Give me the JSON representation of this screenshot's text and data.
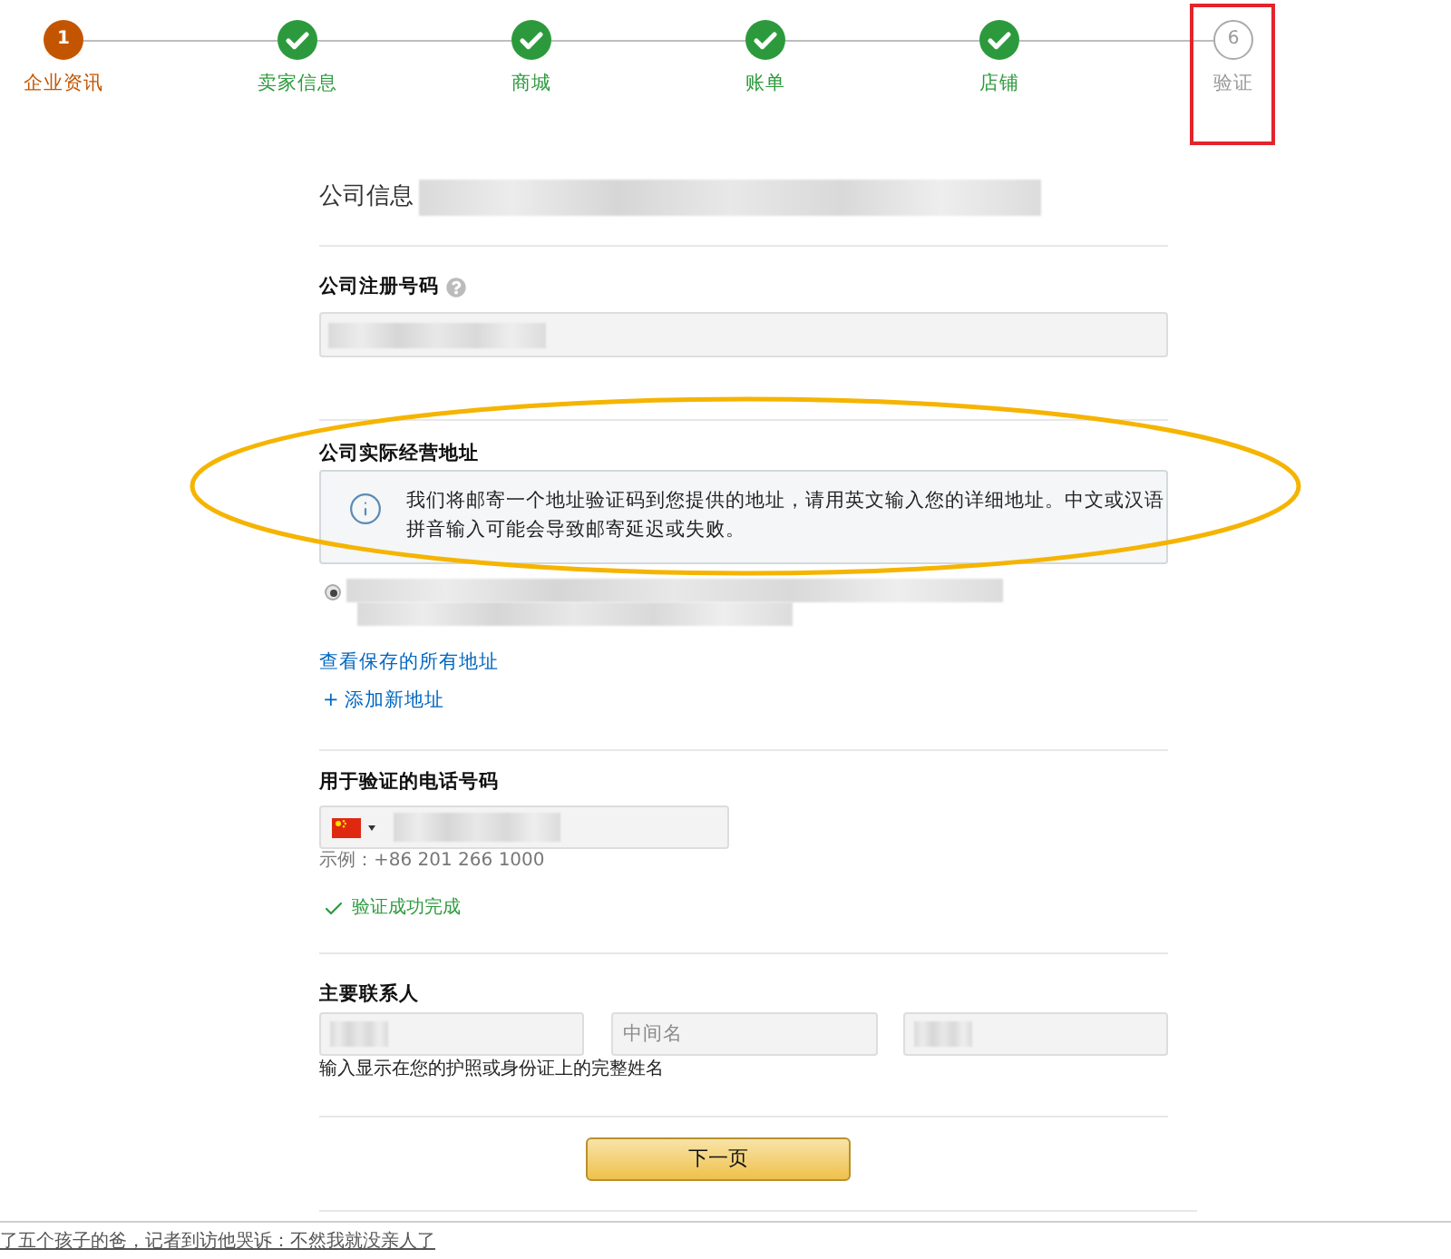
{
  "stepper": {
    "steps": [
      {
        "kind": "current",
        "number": "1",
        "label": "企业资讯",
        "highlighted": false
      },
      {
        "kind": "done",
        "label": "卖家信息",
        "highlighted": false
      },
      {
        "kind": "done",
        "label": "商城",
        "highlighted": false
      },
      {
        "kind": "done",
        "label": "账单",
        "highlighted": false
      },
      {
        "kind": "done",
        "label": "店铺",
        "highlighted": false
      },
      {
        "kind": "pending",
        "number": "6",
        "label": "验证",
        "highlighted": true
      }
    ]
  },
  "company_info": {
    "title": "公司信息"
  },
  "registration_number": {
    "label": "公司注册号码",
    "field": {
      "kind": "filled"
    }
  },
  "business_address": {
    "label": "公司实际经营地址",
    "highlighted": true,
    "notice": "我们将邮寄一个地址验证码到您提供的地址，请用英文输入您的详细地址。中文或汉语拼音输入可能会导致邮寄延迟或失败。",
    "addresses": [
      {
        "selected": true
      }
    ],
    "links": [
      "查看保存的所有地址",
      "+ 添加新地址"
    ]
  },
  "phone": {
    "label": "用于验证的电话号码",
    "example": "示例：+86 201 266 1000",
    "verified": true,
    "verification_text": "验证成功完成"
  },
  "primary_contact": {
    "label": "主要联系人",
    "fields": [
      {
        "kind": "filled"
      },
      {
        "kind": "empty",
        "placeholder": "中间名"
      },
      {
        "kind": "filled"
      }
    ],
    "hint": "输入显示在您的护照或身份证上的完整姓名"
  },
  "next_button": "下一页",
  "footer_link": "了五个孩子的爸，记者到访他哭诉：不然我就没亲人了"
}
